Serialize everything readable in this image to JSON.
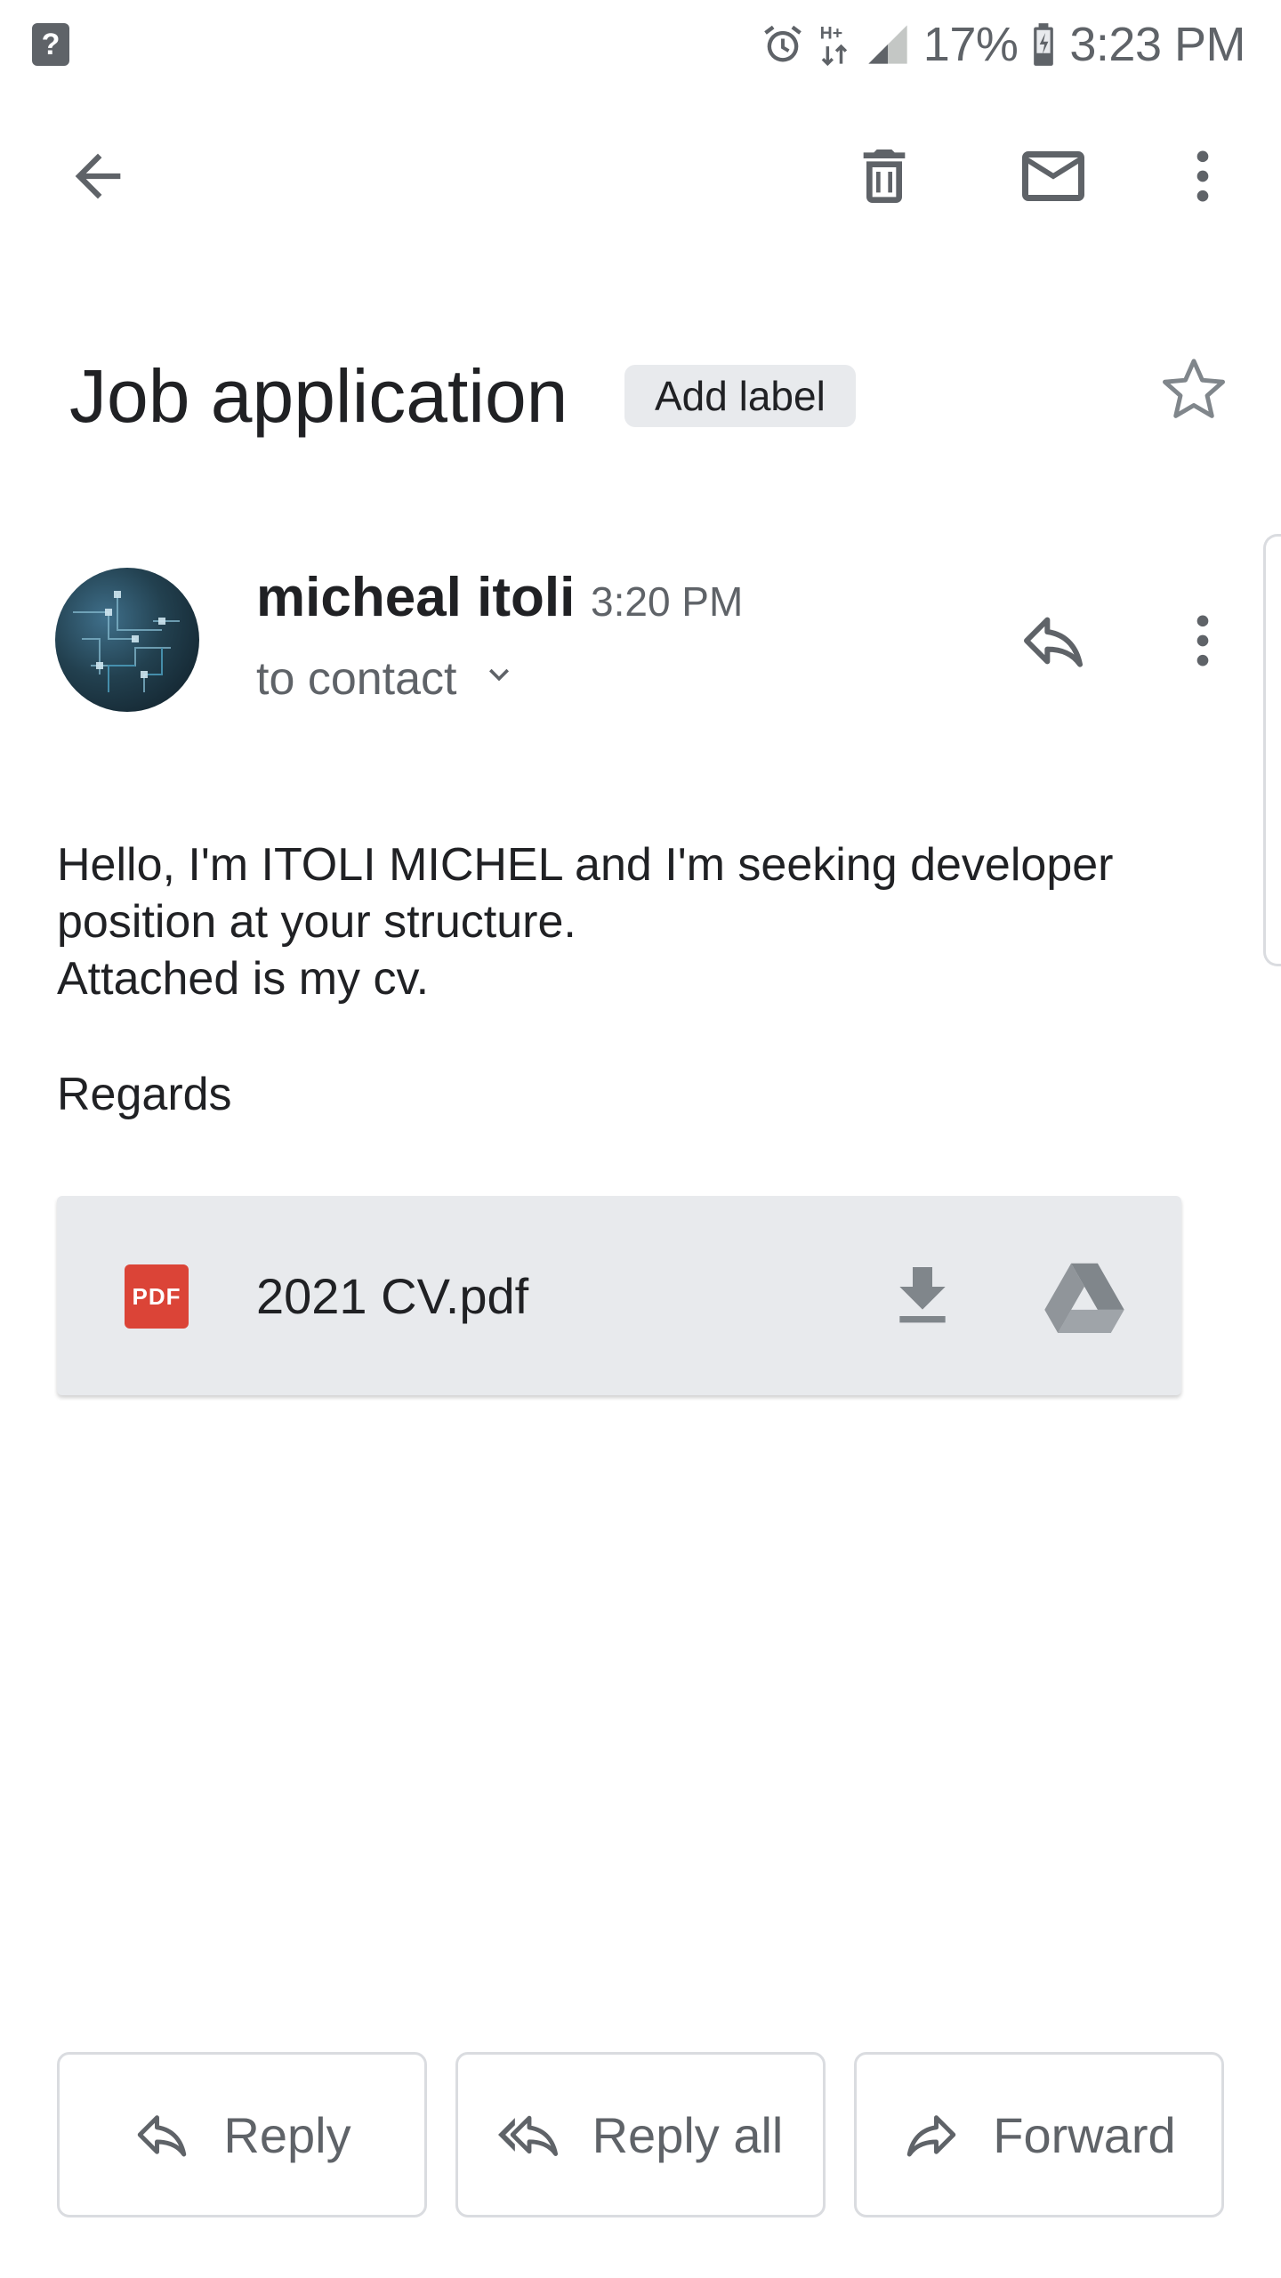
{
  "status_bar": {
    "battery": "17%",
    "time": "3:23 PM",
    "network": "H+"
  },
  "toolbar": {
    "icons": [
      "arrow-back-icon",
      "delete-icon",
      "mark-unread-icon",
      "more-vert-icon"
    ]
  },
  "email": {
    "subject": "Job application",
    "label_button": "Add label",
    "sender_name": "micheal itoli",
    "time": "3:20 PM",
    "recipient": "to contact",
    "body_lines": [
      "Hello, I'm ITOLI MICHEL and I'm seeking developer position at your structure.",
      "Attached is my cv."
    ],
    "signoff": "Regards"
  },
  "attachment": {
    "type_label": "PDF",
    "filename": "2021 CV.pdf"
  },
  "actions": {
    "reply": "Reply",
    "reply_all": "Reply all",
    "forward": "Forward"
  },
  "colors": {
    "icon_gray": "#5f6368",
    "text": "#202124",
    "chip_bg": "#e8eaed",
    "pdf_red": "#db4437"
  }
}
